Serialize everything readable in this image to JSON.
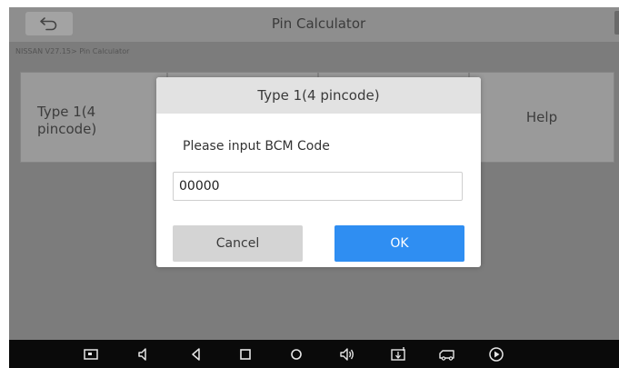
{
  "header": {
    "back_icon": "back-arrow-icon",
    "title": "Pin Calculator"
  },
  "breadcrumb": "NISSAN V27.15> Pin Calculator",
  "cards": {
    "type1_label": "Type 1(4 pincode)",
    "help_label": "Help"
  },
  "dialog": {
    "title": "Type 1(4 pincode)",
    "prompt": "Please input BCM Code",
    "input_value": "00000",
    "cancel_label": "Cancel",
    "ok_label": "OK"
  },
  "navbar": {
    "icons": [
      "screenshot-icon",
      "volume-down-icon",
      "back-icon",
      "home-icon",
      "recents-icon",
      "volume-up-icon",
      "vci-icon",
      "vehicle-icon",
      "play-icon"
    ]
  },
  "colors": {
    "accent": "#2f8ef2",
    "overlay": "#7c7c7c",
    "navbar": "#0a0a0a"
  }
}
